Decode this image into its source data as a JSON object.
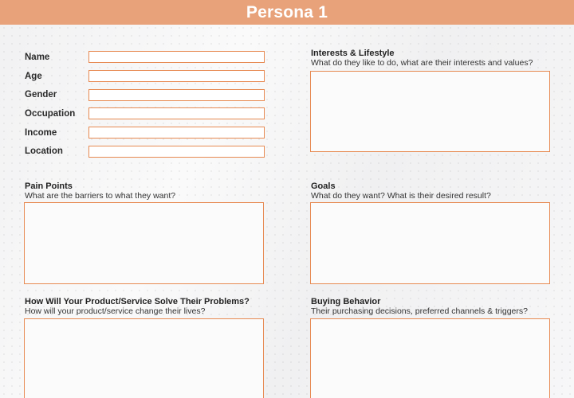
{
  "header": {
    "title": "Persona 1"
  },
  "fields": [
    {
      "label": "Name",
      "value": ""
    },
    {
      "label": "Age",
      "value": ""
    },
    {
      "label": "Gender",
      "value": ""
    },
    {
      "label": "Occupation",
      "value": ""
    },
    {
      "label": "Income",
      "value": ""
    },
    {
      "label": "Location",
      "value": ""
    }
  ],
  "sections": {
    "interests": {
      "title": "Interests & Lifestyle",
      "subtitle": "What do they like to do, what are their interests and values?"
    },
    "pain_points": {
      "title": "Pain Points",
      "subtitle": "What are the barriers to what they want?"
    },
    "goals": {
      "title": "Goals",
      "subtitle": "What do they want? What is their desired result?"
    },
    "solution": {
      "title": "How Will Your Product/Service Solve Their Problems?",
      "subtitle": "How will your product/service change their lives?"
    },
    "buying": {
      "title": "Buying Behavior",
      "subtitle": "Their purchasing decisions, preferred channels & triggers?"
    }
  },
  "colors": {
    "accent": "#e8a27a",
    "border": "#e78a52"
  }
}
